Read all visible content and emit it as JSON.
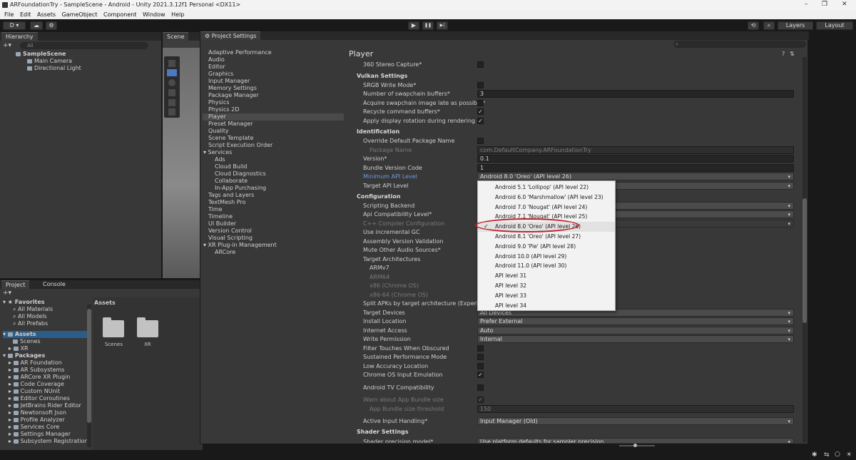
{
  "window": {
    "title": "ARFoundationTry - SampleScene - Android - Unity 2021.3.12f1 Personal <DX11>",
    "controls": [
      "–",
      "❐",
      "✕"
    ]
  },
  "menu": [
    "File",
    "Edit",
    "Assets",
    "GameObject",
    "Component",
    "Window",
    "Help"
  ],
  "toolbar": {
    "account": "D ▾",
    "play": "▶",
    "pause": "❚❚",
    "step": "▶|",
    "layers": "Layers",
    "layout": "Layout"
  },
  "hierarchy": {
    "tab": "Hierarchy",
    "search_placeholder": "All",
    "scene": "SampleScene",
    "items": [
      "Main Camera",
      "Directional Light"
    ]
  },
  "scene_tab": "Scene",
  "project": {
    "tabs": [
      "Project",
      "Console"
    ],
    "favorites_label": "Favorites",
    "favorites": [
      "All Materials",
      "All Models",
      "All Prefabs"
    ],
    "assets_label": "Assets",
    "assets": [
      "Scenes",
      "XR"
    ],
    "packages_label": "Packages",
    "packages": [
      "AR Foundation",
      "AR Subsystems",
      "ARCore XR Plugin",
      "Code Coverage",
      "Custom NUnit",
      "Editor Coroutines",
      "JetBrains Rider Editor",
      "Newtonsoft Json",
      "Profile Analyzer",
      "Services Core",
      "Settings Manager",
      "Subsystem Registration"
    ],
    "breadcrumb": "Assets",
    "folders": [
      "Scenes",
      "XR"
    ]
  },
  "project_settings": {
    "title": "Project Settings",
    "categories": [
      {
        "label": "Adaptive Performance",
        "sub": false
      },
      {
        "label": "Audio",
        "sub": false
      },
      {
        "label": "Editor",
        "sub": false
      },
      {
        "label": "Graphics",
        "sub": false
      },
      {
        "label": "Input Manager",
        "sub": false
      },
      {
        "label": "Memory Settings",
        "sub": false
      },
      {
        "label": "Package Manager",
        "sub": false
      },
      {
        "label": "Physics",
        "sub": false
      },
      {
        "label": "Physics 2D",
        "sub": false
      },
      {
        "label": "Player",
        "sub": false,
        "selected": true
      },
      {
        "label": "Preset Manager",
        "sub": false
      },
      {
        "label": "Quality",
        "sub": false
      },
      {
        "label": "Scene Template",
        "sub": false
      },
      {
        "label": "Script Execution Order",
        "sub": false
      },
      {
        "label": "▾ Services",
        "sub": false
      },
      {
        "label": "Ads",
        "sub": true
      },
      {
        "label": "Cloud Build",
        "sub": true
      },
      {
        "label": "Cloud Diagnostics",
        "sub": true
      },
      {
        "label": "Collaborate",
        "sub": true
      },
      {
        "label": "In-App Purchasing",
        "sub": true
      },
      {
        "label": "Tags and Layers",
        "sub": false
      },
      {
        "label": "TextMesh Pro",
        "sub": false
      },
      {
        "label": "Time",
        "sub": false
      },
      {
        "label": "Timeline",
        "sub": false
      },
      {
        "label": "UI Builder",
        "sub": false
      },
      {
        "label": "Version Control",
        "sub": false
      },
      {
        "label": "Visual Scripting",
        "sub": false
      },
      {
        "label": "▾ XR Plug-in Management",
        "sub": false
      },
      {
        "label": "ARCore",
        "sub": true
      }
    ],
    "page_title": "Player",
    "rows": [
      {
        "kind": "check",
        "label": "360 Stereo Capture*",
        "checked": false
      },
      {
        "kind": "section",
        "label": "Vulkan Settings"
      },
      {
        "kind": "check",
        "label": "SRGB Write Mode*",
        "checked": false
      },
      {
        "kind": "field",
        "label": "Number of swapchain buffers*",
        "value": "3"
      },
      {
        "kind": "check",
        "label": "Acquire swapchain image late as possible*",
        "checked": false
      },
      {
        "kind": "check",
        "label": "Recycle command buffers*",
        "checked": true
      },
      {
        "kind": "check",
        "label": "Apply display rotation during rendering",
        "checked": true
      },
      {
        "kind": "section",
        "label": "Identification"
      },
      {
        "kind": "check",
        "label": "Override Default Package Name",
        "checked": false
      },
      {
        "kind": "field",
        "label": "Package Name",
        "value": "com.DefaultCompany.ARFoundationTry",
        "indent": true,
        "disabled": true
      },
      {
        "kind": "field",
        "label": "Version*",
        "value": "0.1"
      },
      {
        "kind": "field",
        "label": "Bundle Version Code",
        "value": "1"
      },
      {
        "kind": "dropdown",
        "label": "Minimum API Level",
        "value": "Android 8.0 'Oreo' (API level 26)",
        "highlight": true
      },
      {
        "kind": "dropdown",
        "label": "Target API Level",
        "value": ""
      },
      {
        "kind": "section",
        "label": "Configuration"
      },
      {
        "kind": "dropdown",
        "label": "Scripting Backend",
        "value": ""
      },
      {
        "kind": "dropdown",
        "label": "Api Compatibility Level*",
        "value": ""
      },
      {
        "kind": "dropdown",
        "label": "C++ Compiler Configuration",
        "value": "",
        "disabled": true
      },
      {
        "kind": "check",
        "label": "Use incremental GC",
        "checked": false
      },
      {
        "kind": "check",
        "label": "Assembly Version Validation",
        "checked": false
      },
      {
        "kind": "check",
        "label": "Mute Other Audio Sources*",
        "checked": false
      },
      {
        "kind": "label",
        "label": "Target Architectures"
      },
      {
        "kind": "check",
        "label": "ARMv7",
        "checked": false,
        "indent": true
      },
      {
        "kind": "check",
        "label": "ARM64",
        "checked": false,
        "indent": true,
        "disabled": true
      },
      {
        "kind": "check",
        "label": "x86 (Chrome OS)",
        "checked": false,
        "indent": true,
        "disabled": true
      },
      {
        "kind": "check",
        "label": "x86-64 (Chrome OS)",
        "checked": false,
        "indent": true,
        "disabled": true
      },
      {
        "kind": "check",
        "label": "Split APKs by target architecture (Experimenta",
        "checked": false
      },
      {
        "kind": "dropdown",
        "label": "Target Devices",
        "value": "All Devices"
      },
      {
        "kind": "dropdown",
        "label": "Install Location",
        "value": "Prefer External"
      },
      {
        "kind": "dropdown",
        "label": "Internet Access",
        "value": "Auto"
      },
      {
        "kind": "dropdown",
        "label": "Write Permission",
        "value": "Internal"
      },
      {
        "kind": "check",
        "label": "Filter Touches When Obscured",
        "checked": false
      },
      {
        "kind": "check",
        "label": "Sustained Performance Mode",
        "checked": false
      },
      {
        "kind": "check",
        "label": "Low Accuracy Location",
        "checked": false
      },
      {
        "kind": "check",
        "label": "Chrome OS Input Emulation",
        "checked": true
      },
      {
        "kind": "gap"
      },
      {
        "kind": "check",
        "label": "Android TV Compatibility",
        "checked": false
      },
      {
        "kind": "gap"
      },
      {
        "kind": "check",
        "label": "Warn about App Bundle size",
        "checked": true,
        "disabled": true
      },
      {
        "kind": "field",
        "label": "App Bundle size threshold",
        "value": "150",
        "indent": true,
        "disabled": true
      },
      {
        "kind": "gap"
      },
      {
        "kind": "dropdown",
        "label": "Active Input Handling*",
        "value": "Input Manager (Old)"
      },
      {
        "kind": "gap"
      },
      {
        "kind": "section",
        "label": "Shader Settings"
      },
      {
        "kind": "dropdown",
        "label": "Shader precision model*",
        "value": "Use platform defaults for sampler precision"
      }
    ],
    "api_options": [
      {
        "label": "Android 5.1 'Lollipop' (API level 22)",
        "selected": false
      },
      {
        "label": "Android 6.0 'Marshmallow' (API level 23)",
        "selected": false
      },
      {
        "label": "Android 7.0 'Nougat' (API level 24)",
        "selected": false
      },
      {
        "label": "Android 7.1 'Nougat' (API level 25)",
        "selected": false
      },
      {
        "label": "Android 8.0 'Oreo' (API level 26)",
        "selected": true
      },
      {
        "label": "Android 8.1 'Oreo' (API level 27)",
        "selected": false
      },
      {
        "label": "Android 9.0 'Pie' (API level 28)",
        "selected": false
      },
      {
        "label": "Android 10.0 (API level 29)",
        "selected": false
      },
      {
        "label": "Android 11.0 (API level 30)",
        "selected": false
      },
      {
        "label": "API level 31",
        "selected": false
      },
      {
        "label": "API level 32",
        "selected": false
      },
      {
        "label": "API level 33",
        "selected": false
      },
      {
        "label": "API level 34",
        "selected": false
      }
    ],
    "check_glyph": "✓",
    "annotation_color": "#c41e2a"
  }
}
